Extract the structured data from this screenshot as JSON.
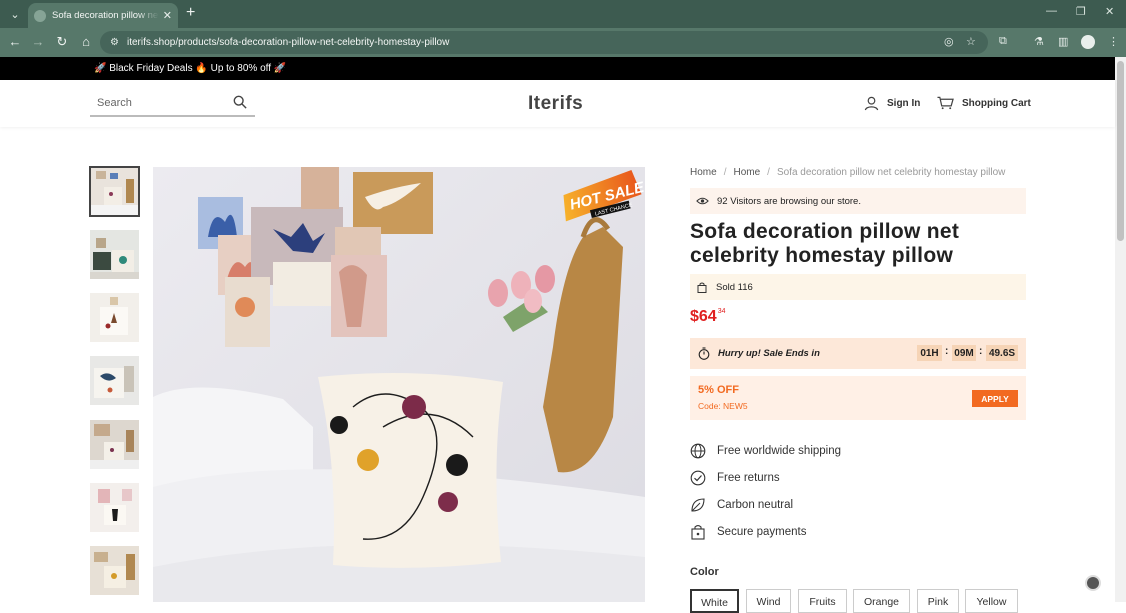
{
  "browser": {
    "tab_title": "Sofa decoration pillow net celebrity homestay pillow",
    "url": "iterifs.shop/products/sofa-decoration-pillow-net-celebrity-homestay-pillow"
  },
  "promo_bar": {
    "text": "🚀 Black Friday Deals 🔥 Up to 80% off 🚀"
  },
  "header": {
    "search_placeholder": "Search",
    "logo": "Iterifs",
    "sign_in": "Sign In",
    "cart": "Shopping Cart"
  },
  "breadcrumb": [
    "Home",
    "Home",
    "Sofa decoration pillow net celebrity homestay pillow"
  ],
  "product": {
    "visitors_text": "92 Visitors are browsing our store.",
    "title": "Sofa decoration pillow net celebrity homestay pillow",
    "sold_text": "Sold 116",
    "price_main": "$64",
    "price_cents": "34",
    "timer_label": "Hurry up! Sale Ends in",
    "timer": {
      "hours": "01H",
      "minutes": "09M",
      "seconds": "49.6S"
    },
    "badge_text": "HOT SALE",
    "badge_sub": "LAST CHANCE"
  },
  "coupon": {
    "discount": "5% OFF",
    "code": "Code: NEW5",
    "apply": "APPLY"
  },
  "features": [
    "Free worldwide shipping",
    "Free returns",
    "Carbon neutral",
    "Secure payments"
  ],
  "color": {
    "label": "Color",
    "options": [
      "White",
      "Wind",
      "Fruits",
      "Orange",
      "Pink",
      "Yellow"
    ],
    "selected": "White"
  },
  "thumbnails": 7
}
